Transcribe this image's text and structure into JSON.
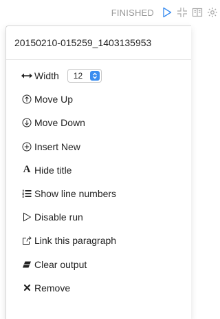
{
  "toolbar": {
    "status": "FINISHED",
    "icons": [
      "play-icon",
      "collapse-icon",
      "book-icon",
      "gear-icon"
    ]
  },
  "menu": {
    "header": "20150210-015259_1403135953",
    "items": [
      {
        "label": "Width",
        "icon": "resize-horizontal-icon"
      },
      {
        "label": "Move Up",
        "icon": "arrow-up-circle-icon"
      },
      {
        "label": "Move Down",
        "icon": "arrow-down-circle-icon"
      },
      {
        "label": "Insert New",
        "icon": "plus-circle-icon"
      },
      {
        "label": "Hide title",
        "icon": "font-icon"
      },
      {
        "label": "Show line numbers",
        "icon": "list-numbered-icon"
      },
      {
        "label": "Disable run",
        "icon": "play-outline-icon"
      },
      {
        "label": "Link this paragraph",
        "icon": "share-icon"
      },
      {
        "label": "Clear output",
        "icon": "eraser-icon"
      },
      {
        "label": "Remove",
        "icon": "close-icon"
      }
    ],
    "width_value": "12"
  },
  "colors": {
    "accent": "#3b8df0",
    "status": "#9a9a9a"
  }
}
